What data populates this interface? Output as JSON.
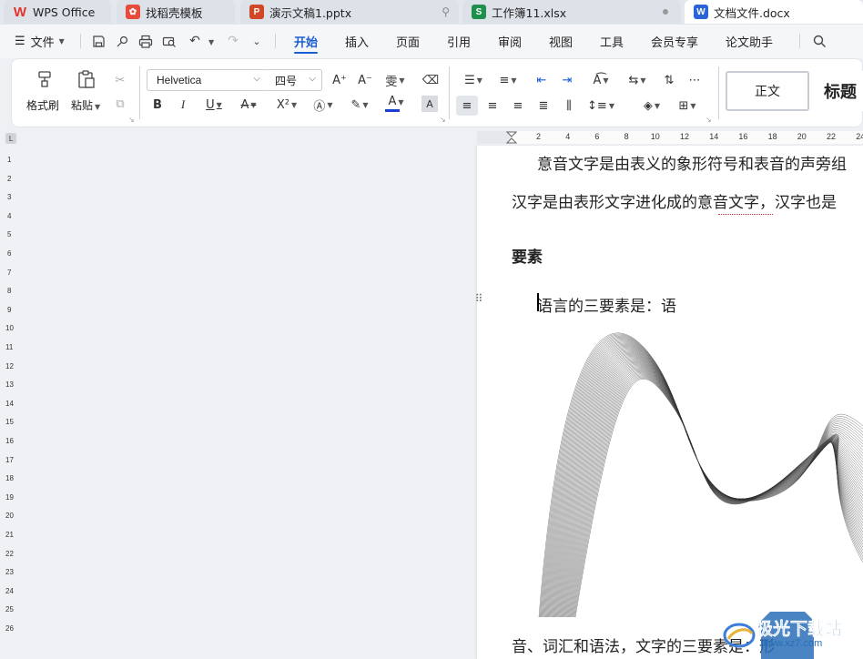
{
  "tabs": [
    {
      "label": "WPS Office",
      "icon": "wps-logo-icon",
      "color": "#e0342d"
    },
    {
      "label": "找稻壳模板",
      "icon": "docer-icon",
      "color": "#e84a3c"
    },
    {
      "label": "演示文稿1.pptx",
      "icon": "presentation-icon",
      "color": "#d24726"
    },
    {
      "label": "工作簿11.xlsx",
      "icon": "spreadsheet-icon",
      "color": "#1f8f4e"
    },
    {
      "label": "文档文件.docx",
      "icon": "document-icon",
      "color": "#2b63d8"
    }
  ],
  "menu": {
    "file_label": "文件",
    "items": [
      "开始",
      "插入",
      "页面",
      "引用",
      "审阅",
      "视图",
      "工具",
      "会员专享",
      "论文助手"
    ],
    "active": "开始"
  },
  "ribbon": {
    "format_painter": "格式刷",
    "paste": "粘贴",
    "font_name": "Helvetica",
    "font_size": "四号",
    "style_normal": "正文",
    "style_heading": "标题"
  },
  "ruler": {
    "horizontal": [
      "2",
      "4",
      "6",
      "8",
      "10",
      "12",
      "14",
      "16",
      "18",
      "20",
      "22",
      "24"
    ],
    "vertical": [
      "1",
      "2",
      "3",
      "4",
      "5",
      "6",
      "7",
      "8",
      "9",
      "10",
      "11",
      "12",
      "13",
      "14",
      "15",
      "16",
      "17",
      "18",
      "19",
      "20",
      "21",
      "22",
      "23",
      "24",
      "25",
      "26"
    ]
  },
  "document": {
    "line1": "意音文字是由表义的象形符号和表音的声旁组",
    "line2": "汉字是由表形文字进化成的意音文字，汉字也是",
    "heading": "要素",
    "line3": "语言的三要素是：语",
    "line4": "音、词汇和语法，文字的三要素是：形"
  },
  "watermark": {
    "text": "极光下载站",
    "url": "www.xz7.com"
  },
  "colors": {
    "accent": "#1a5fd0",
    "font_color_bar": "#1a3fd0"
  }
}
